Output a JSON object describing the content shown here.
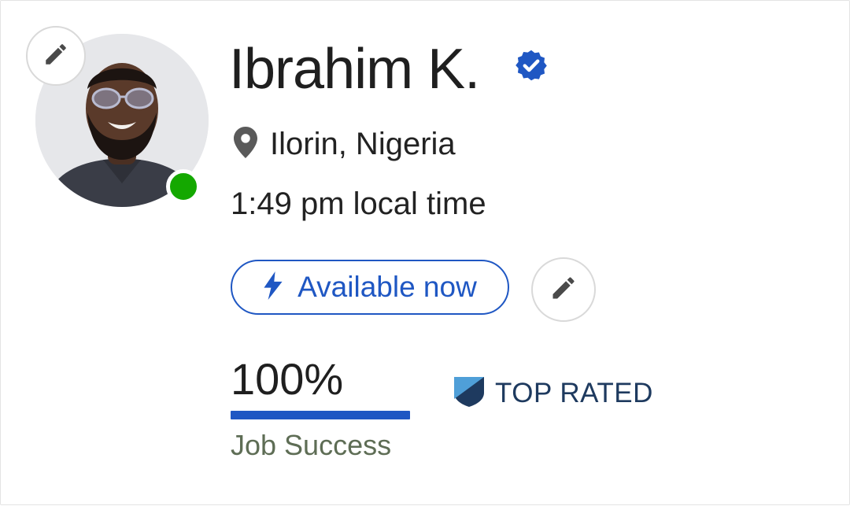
{
  "profile": {
    "name": "Ibrahim K.",
    "verified_icon": "verified-badge-icon",
    "location": "Ilorin, Nigeria",
    "local_time": "1:49 pm local time",
    "online_status_color": "#14a800",
    "availability": {
      "label": "Available now",
      "icon": "lightning-bolt-icon"
    },
    "job_success": {
      "value": "100%",
      "label": "Job Success",
      "fraction": 1.0
    },
    "badge": {
      "label": "TOP RATED",
      "icon": "top-rated-shield-icon"
    }
  },
  "colors": {
    "accent_blue": "#1f57c3",
    "online_green": "#14a800",
    "badge_navy": "#1e3a5f",
    "badge_light": "#4f9fd8",
    "muted_text": "#5e6d55"
  },
  "icons": {
    "edit": "pencil-icon",
    "location": "map-pin-icon"
  }
}
